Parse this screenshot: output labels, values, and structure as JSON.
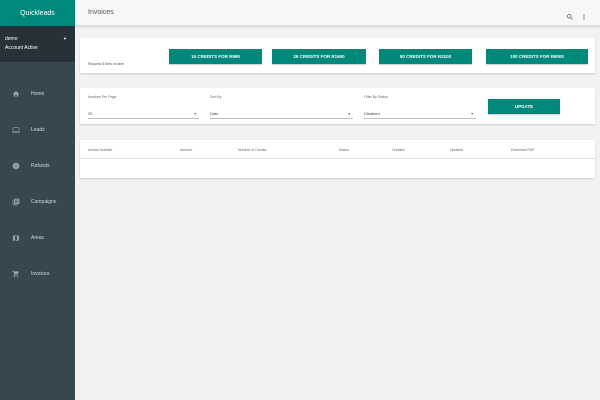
{
  "app": {
    "brand": "Quickleads"
  },
  "account": {
    "user": "demo",
    "status": "Account Active"
  },
  "sidebar": {
    "items": [
      {
        "label": "Home",
        "icon": "home-icon"
      },
      {
        "label": "Leads",
        "icon": "leads-icon"
      },
      {
        "label": "Refunds",
        "icon": "refunds-icon"
      },
      {
        "label": "Campaigns",
        "icon": "campaigns-icon"
      },
      {
        "label": "Areas",
        "icon": "areas-icon"
      },
      {
        "label": "Invoices",
        "icon": "invoices-icon"
      }
    ]
  },
  "header": {
    "title": "Invoices"
  },
  "credits": {
    "label": "Request A New Invoice",
    "buttons": [
      "15 CREDITS FOR R990",
      "25 CREDITS FOR R1600",
      "50 CREDITS FOR R3100",
      "100 CREDITS FOR R6000"
    ]
  },
  "filters": {
    "per_page": {
      "label": "Invoices Per Page",
      "value": "25"
    },
    "sort_by": {
      "label": "Sort By",
      "value": "Date"
    },
    "status": {
      "label": "Filter By Status",
      "value": "Disabled"
    },
    "update_label": "UPDATE"
  },
  "table": {
    "columns": [
      "Invoice Number",
      "Amount",
      "Number of Credits",
      "Status",
      "Created",
      "Updated",
      "Download PDF"
    ]
  },
  "colors": {
    "accent": "#00897b",
    "sidebar": "#37474f",
    "sidebar_dark": "#263238"
  }
}
